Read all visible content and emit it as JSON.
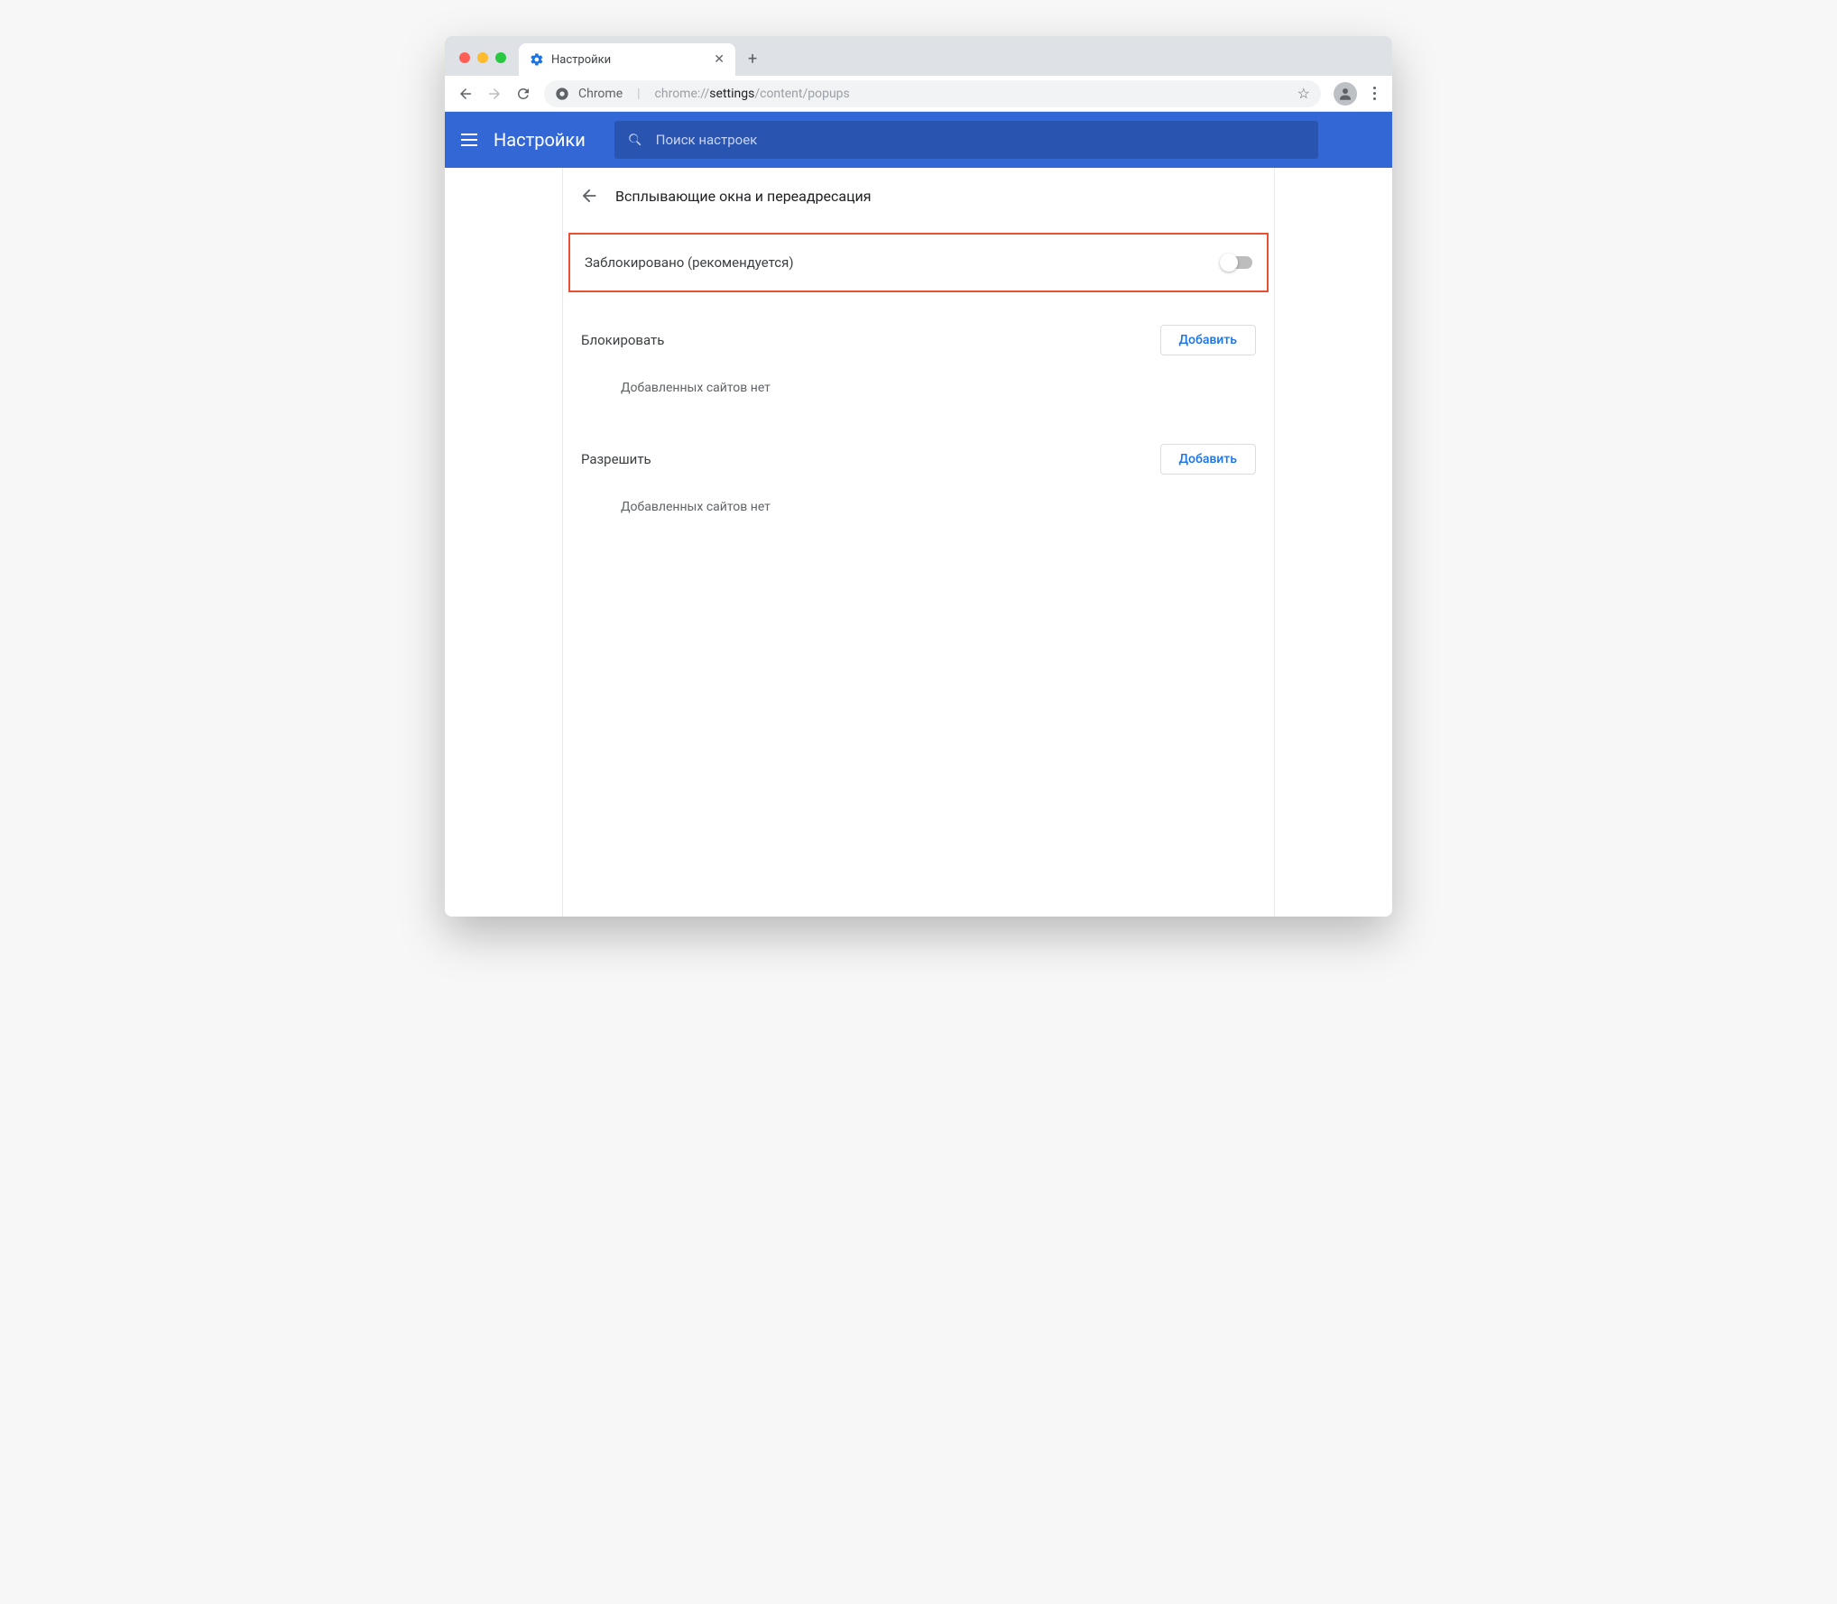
{
  "tab": {
    "title": "Настройки"
  },
  "omnibox": {
    "secure_label": "Chrome",
    "url_prefix": "chrome://",
    "url_bold": "settings",
    "url_suffix": "/content/popups"
  },
  "appbar": {
    "title": "Настройки",
    "search_placeholder": "Поиск настроек"
  },
  "page": {
    "heading": "Всплывающие окна и переадресация",
    "toggle_label": "Заблокировано (рекомендуется)",
    "block_section": {
      "title": "Блокировать",
      "add_label": "Добавить",
      "empty": "Добавленных сайтов нет"
    },
    "allow_section": {
      "title": "Разрешить",
      "add_label": "Добавить",
      "empty": "Добавленных сайтов нет"
    }
  }
}
